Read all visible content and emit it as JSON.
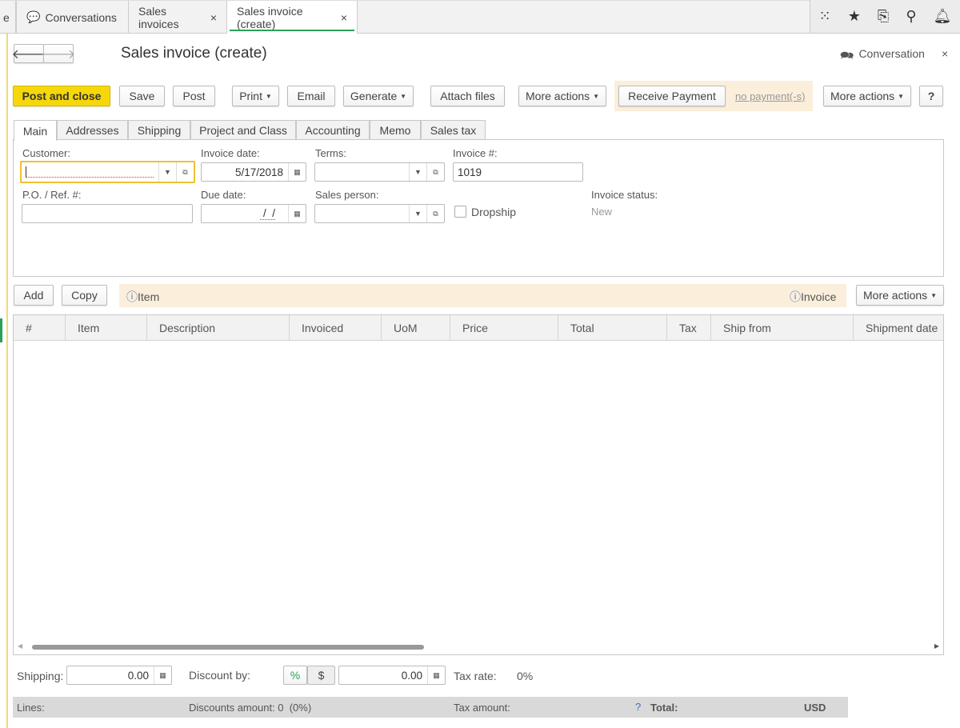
{
  "window_tabs": [
    {
      "label": "e"
    },
    {
      "label": "Conversations"
    },
    {
      "label": "Sales invoices",
      "close": "×"
    },
    {
      "label": "Sales invoice (create)",
      "close": "×"
    }
  ],
  "header": {
    "title": "Sales invoice (create)",
    "conversation": "Conversation",
    "close": "×"
  },
  "toolbar": {
    "post_close": "Post and close",
    "save": "Save",
    "post": "Post",
    "print": "Print",
    "email": "Email",
    "generate": "Generate",
    "attach": "Attach files",
    "more1": "More actions",
    "receive": "Receive Payment",
    "no_payment": "no payment(-s)",
    "more2": "More actions",
    "help": "?"
  },
  "form_tabs": [
    "Main",
    "Addresses",
    "Shipping",
    "Project and Class",
    "Accounting",
    "Memo",
    "Sales tax"
  ],
  "form": {
    "customer_label": "Customer:",
    "customer_value": "",
    "invoice_date_label": "Invoice date:",
    "invoice_date_value": "5/17/2018",
    "terms_label": "Terms:",
    "terms_value": "",
    "invoice_no_label": "Invoice #:",
    "invoice_no_value": "1019",
    "po_label": "P.O. / Ref. #:",
    "po_value": "",
    "due_date_label": "Due date:",
    "due_date_value": " /  /",
    "sales_person_label": "Sales person:",
    "dropship_label": "Dropship",
    "status_label": "Invoice status:",
    "status_value": "New"
  },
  "lines_toolbar": {
    "add": "Add",
    "copy": "Copy",
    "item_info": "Item",
    "invoice_info": "Invoice",
    "more": "More actions"
  },
  "table": {
    "columns": [
      "#",
      "Item",
      "Description",
      "Invoiced",
      "UoM",
      "Price",
      "Total",
      "Tax",
      "Ship from",
      "Shipment date"
    ]
  },
  "footer": {
    "shipping_label": "Shipping:",
    "shipping_value": "0.00",
    "discount_label": "Discount by:",
    "pct": "%",
    "dollar": "$",
    "discount_value": "0.00",
    "tax_rate_label": "Tax rate:",
    "tax_rate_value": "0%"
  },
  "totals": {
    "lines": "Lines:",
    "discounts": "Discounts amount: 0  (0%)",
    "tax": "Tax amount:",
    "q": "?",
    "total": "Total:",
    "currency": "USD"
  }
}
